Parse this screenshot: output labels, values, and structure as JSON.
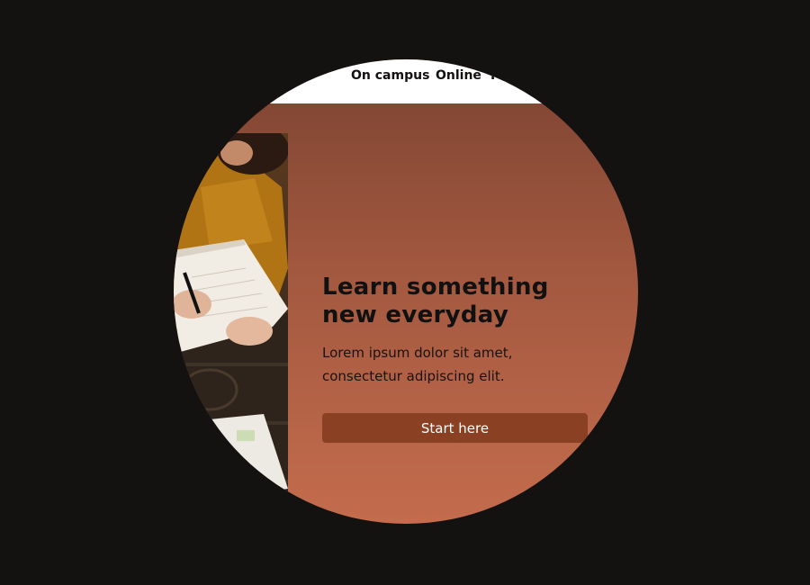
{
  "nav": {
    "links": [
      {
        "label": "On campus"
      },
      {
        "label": "Online"
      },
      {
        "label": "F"
      }
    ]
  },
  "hero": {
    "title_line1": "Learn something",
    "title_line2": "new everyday",
    "body_line1": "Lorem ipsum dolor sit amet,",
    "body_line2": "consectetur adipiscing elit.",
    "cta_label": "Start here"
  },
  "colors": {
    "page_background": "#141111",
    "navbar_background": "#ffffff",
    "hero_gradient_top": "#7c4331",
    "hero_gradient_bottom": "#c46c4d",
    "cta_background": "#8a4123",
    "cta_text": "#ffffff",
    "heading_text": "#111111"
  }
}
